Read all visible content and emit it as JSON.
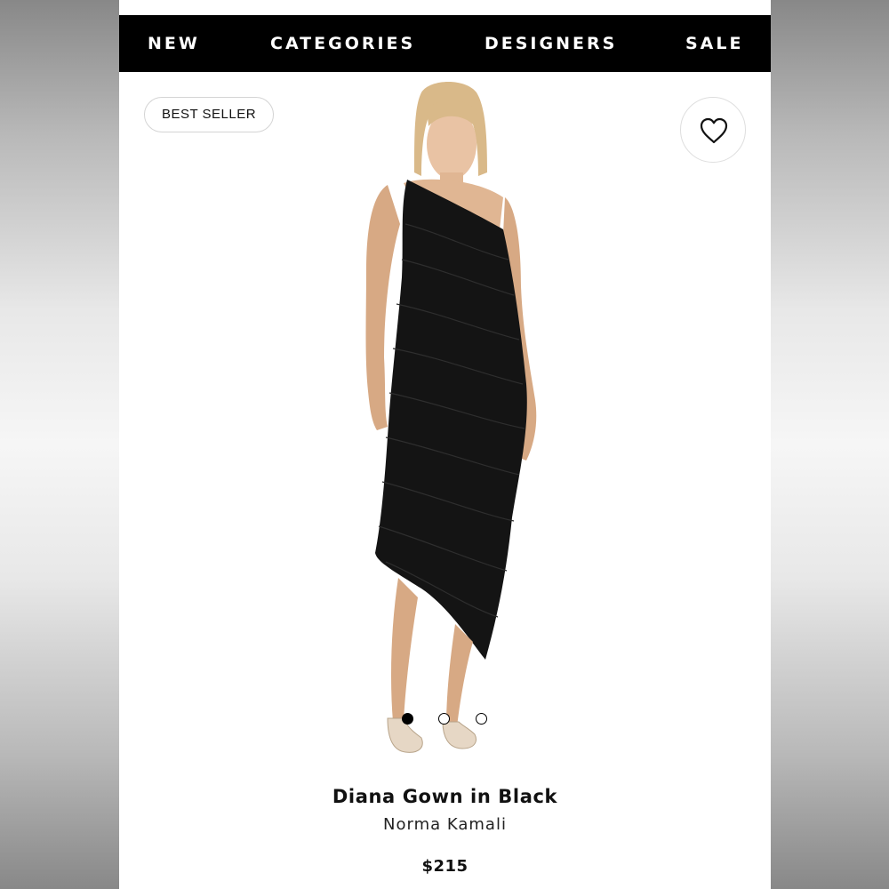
{
  "nav": {
    "items": [
      {
        "label": "NEW"
      },
      {
        "label": "CATEGORIES"
      },
      {
        "label": "DESIGNERS"
      },
      {
        "label": "SALE"
      }
    ]
  },
  "badge": {
    "label": "BEST SELLER"
  },
  "favorite": {
    "icon": "heart-outline-icon"
  },
  "product": {
    "name": "Diana Gown in Black",
    "designer": "Norma Kamali",
    "price": "$215",
    "image": "model-wearing-black-one-shoulder-ruched-gown"
  },
  "carousel": {
    "total": 3,
    "active_index": 1
  },
  "colors": {
    "nav_background": "#000000",
    "nav_text": "#ffffff",
    "page_background": "#ffffff",
    "dress": "#141414"
  }
}
